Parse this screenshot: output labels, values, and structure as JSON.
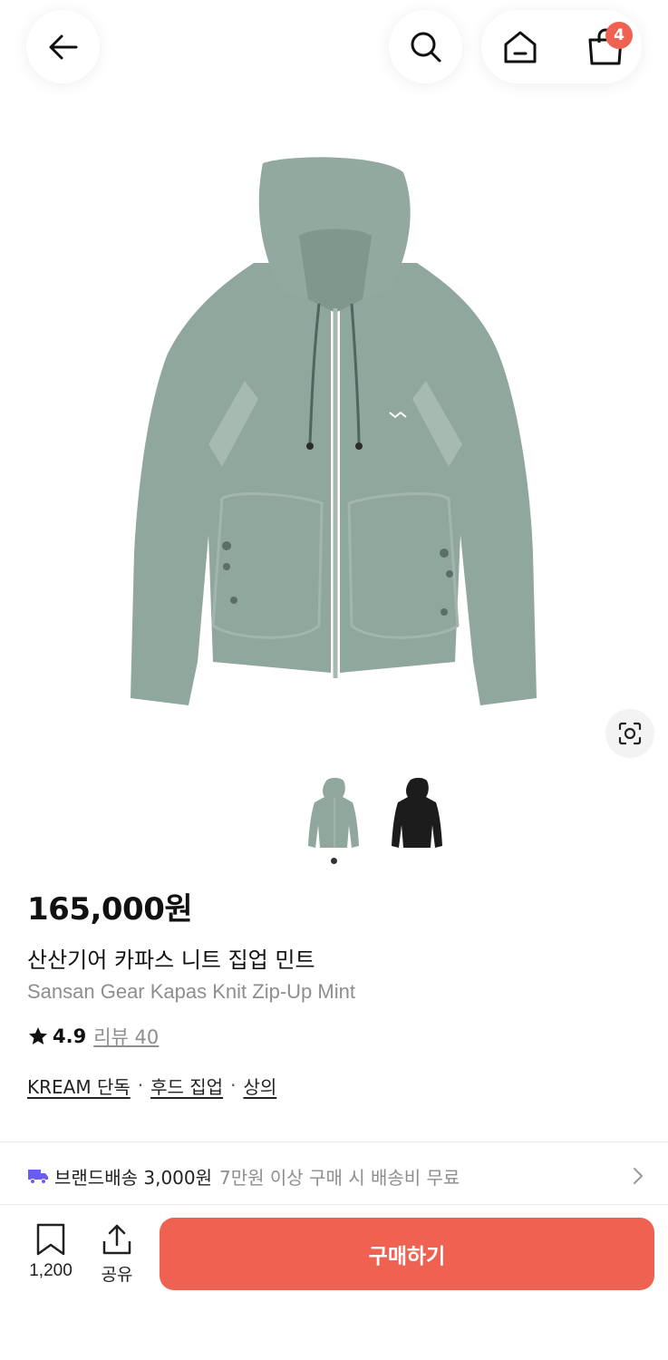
{
  "header": {
    "cart_badge": "4"
  },
  "product": {
    "price": "165,000원",
    "name_ko": "산산기어 카파스 니트 집업 민트",
    "name_en": "Sansan Gear Kapas Knit Zip-Up Mint",
    "rating": "4.9",
    "review_label": "리뷰 40",
    "image_index": 1,
    "image_count": 2,
    "thumb_colors": [
      "#8fa79c",
      "#1c1c1c"
    ],
    "tags": [
      {
        "label": "KREAM 단독"
      },
      {
        "label": "후드 집업"
      },
      {
        "label": "상의"
      }
    ],
    "tag_separator": "·"
  },
  "shipping": {
    "label": "브랜드배송 3,000원",
    "note": "7만원 이상 구매 시 배송비 무료"
  },
  "bottom_bar": {
    "bookmark_count": "1,200",
    "share_label": "공유",
    "buy_label": "구매하기"
  },
  "colors": {
    "accent": "#ef6252",
    "truck": "#6b5cf0",
    "muted_text": "#8e8e8e",
    "product_mint": "#8fa79c"
  }
}
